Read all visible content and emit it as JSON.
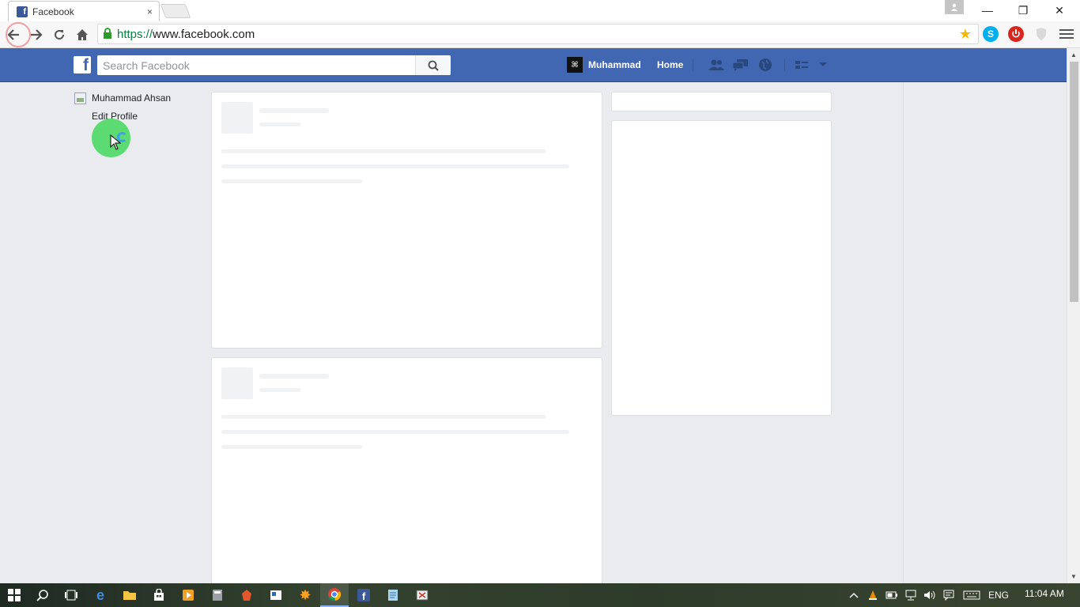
{
  "browser": {
    "tab_title": "Facebook",
    "tab_close": "×",
    "url": "https://www.facebook.com",
    "url_scheme": "https://",
    "url_host": "www.facebook.com",
    "window_controls": {
      "minimize": "—",
      "restore": "❐",
      "close": "✕"
    }
  },
  "facebook": {
    "search_placeholder": "Search Facebook",
    "user_short_name": "Muhammad",
    "home_label": "Home",
    "logo_letter": "f"
  },
  "left_nav": {
    "profile_name": "Muhammad Ahsan",
    "edit_profile": "Edit Profile"
  },
  "taskbar": {
    "language": "ENG",
    "time": "11:04 AM"
  },
  "colors": {
    "fb_blue": "#4267b2",
    "page_bg": "#e9ebee",
    "click_indicator": "#4cd964"
  }
}
